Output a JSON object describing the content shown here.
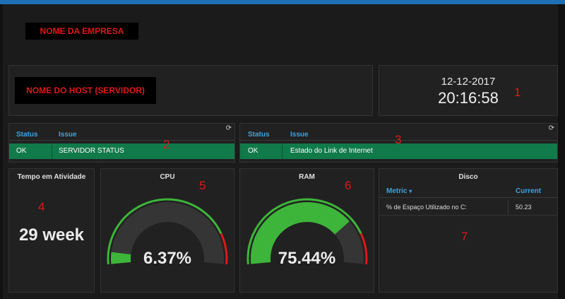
{
  "header": {
    "company_name": "NOME DA EMPRESA"
  },
  "host": {
    "name": "NOME DO HOST (SERVIDOR)"
  },
  "clock": {
    "date": "12-12-2017",
    "time": "20:16:58"
  },
  "markers": [
    "1",
    "2",
    "3",
    "4",
    "5",
    "6",
    "7"
  ],
  "status_left": {
    "columns": [
      "Status",
      "Issue"
    ],
    "rows": [
      {
        "status": "OK",
        "issue": "SERVIDOR STATUS"
      }
    ]
  },
  "status_right": {
    "columns": [
      "Status",
      "Issue"
    ],
    "rows": [
      {
        "status": "OK",
        "issue": "Estado do Link de Internet"
      }
    ]
  },
  "uptime": {
    "title": "Tempo em Atividade",
    "value": "29 week"
  },
  "cpu": {
    "title": "CPU",
    "value_label": "6.37%",
    "percent": 6.37
  },
  "ram": {
    "title": "RAM",
    "value_label": "75.44%",
    "percent": 75.44
  },
  "disk": {
    "title": "Disco",
    "columns": [
      "Metric",
      "Current"
    ],
    "rows": [
      {
        "metric": "% de Espaço Utilizado no C:",
        "current": "50.23"
      }
    ]
  },
  "colors": {
    "accent_blue": "#3ea3e0",
    "ok_green": "#117a4a",
    "gauge_green": "#3db53a",
    "gauge_red": "#e01818",
    "marker_red": "#e01818"
  },
  "icons": [
    "refresh-icon",
    "sort-caret-icon"
  ]
}
